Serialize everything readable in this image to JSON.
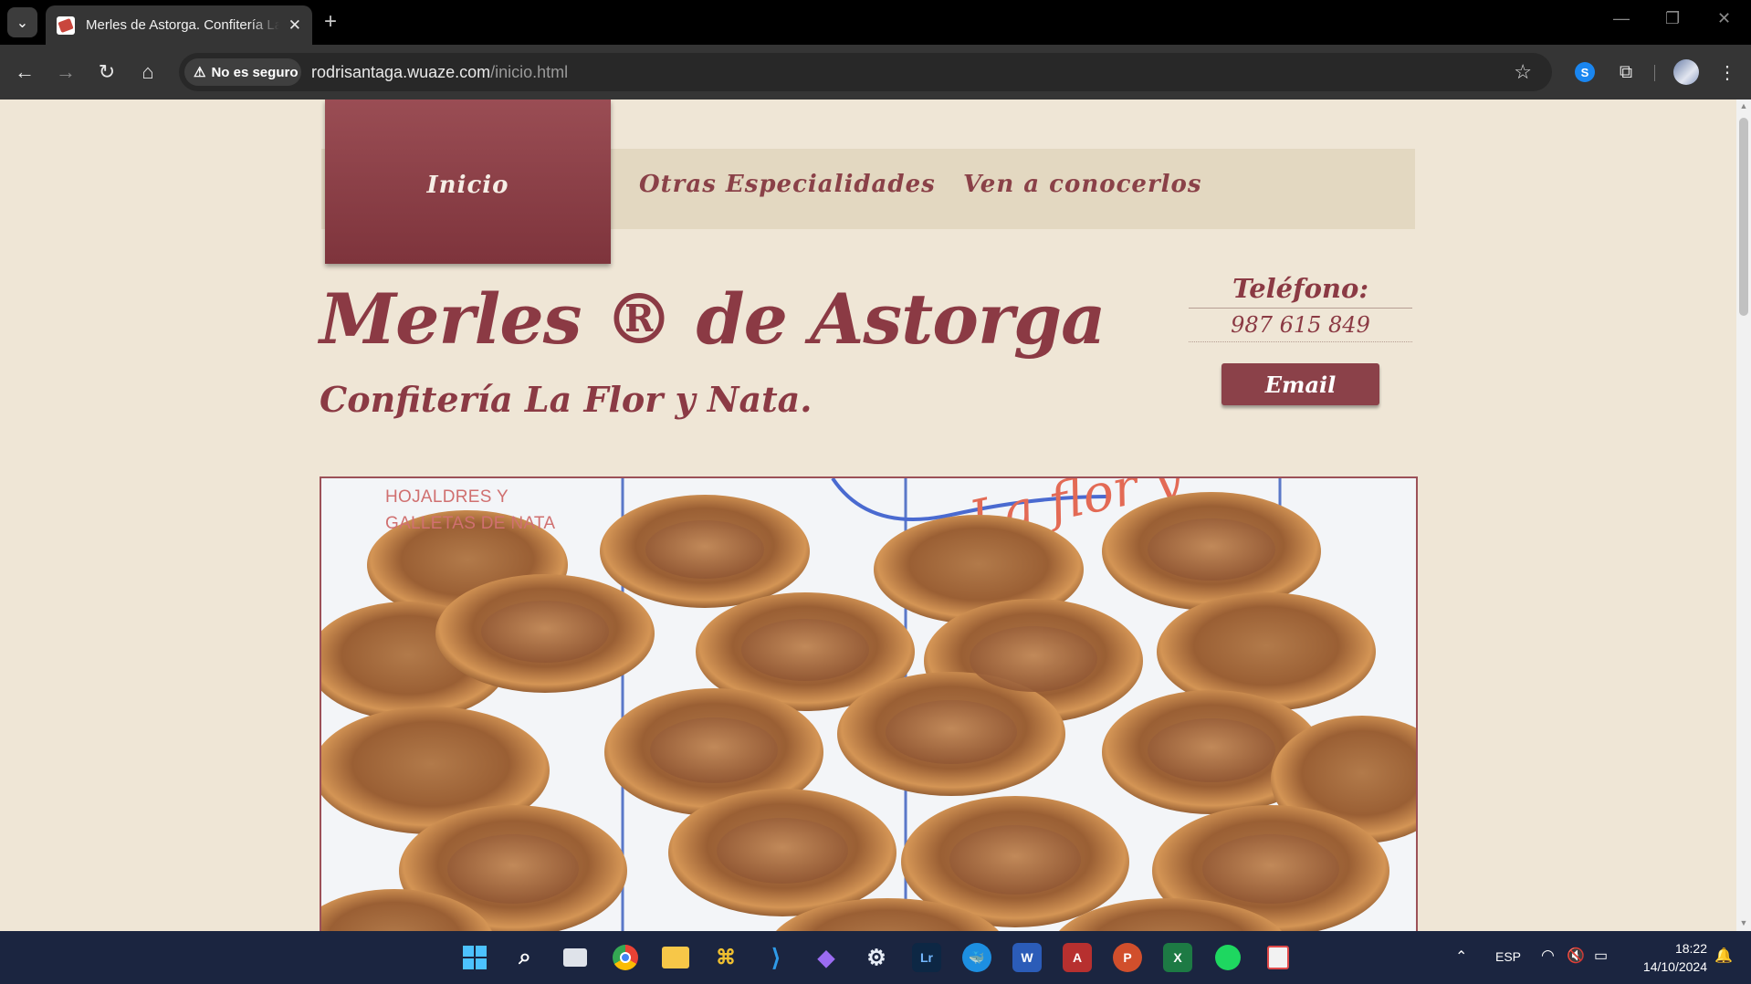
{
  "browser": {
    "tab_title": "Merles de Astorga. Confitería La Flor y Nata.",
    "tab_close": "✕",
    "new_tab": "+",
    "security_chip": "No es seguro",
    "url_host": "rodrisantaga.wuaze.com",
    "url_path": "/inicio.html",
    "window_controls": [
      "—",
      "❐",
      "✕"
    ]
  },
  "nav": {
    "items": [
      {
        "label": "Inicio",
        "active": true
      },
      {
        "label": "Otras Especialidades",
        "active": false
      },
      {
        "label": "Ven a conocerlos",
        "active": false
      }
    ]
  },
  "header": {
    "brand": "Merles ®  de Astorga",
    "tagline": "Confitería La Flor y Nata."
  },
  "contact": {
    "phone_label": "Teléfono:",
    "phone_number": "987 615 849",
    "email_label": "Email"
  },
  "hero": {
    "caption_line1": "HOJALDRES Y",
    "caption_line2": "GALLETAS DE NATA",
    "sign_text": "La flor y"
  },
  "taskbar": {
    "language": "ESP",
    "time": "18:22",
    "date": "14/10/2024",
    "apps": [
      "start-icon",
      "search-icon",
      "task-view-icon",
      "chrome-icon",
      "file-explorer-icon",
      "git-icon",
      "vscode-icon",
      "obsidian-icon",
      "steam-icon",
      "lightroom-icon",
      "docker-icon",
      "word-icon",
      "access-icon",
      "powerpoint-icon",
      "excel-icon",
      "spotify-icon",
      "snipping-tool-icon"
    ],
    "lightroom_label": "Lr",
    "word_label": "W",
    "access_label": "A",
    "powerpoint_label": "P",
    "excel_label": "X"
  },
  "colors": {
    "brand": "#8b3a44",
    "page_bg": "#efe6d6",
    "nav_bg": "#e3d8c1"
  }
}
